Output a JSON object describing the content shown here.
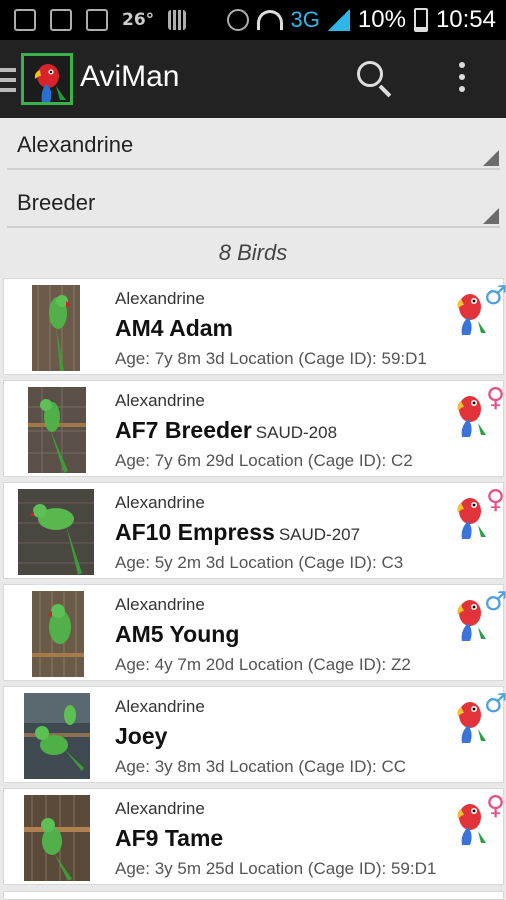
{
  "status_bar": {
    "temperature": "26°",
    "network": "3G",
    "battery": "10%",
    "time": "10:54"
  },
  "action_bar": {
    "app_title": "AviMan"
  },
  "filters": {
    "species": "Alexandrine",
    "category": "Breeder"
  },
  "count_label": "8 Birds",
  "birds": [
    {
      "species": "Alexandrine",
      "name": "AM4 Adam",
      "ring": "",
      "age": "Age: 7y 8m 3d",
      "location": "Location (Cage ID): 59:D1",
      "sex": "male",
      "sex_symbol": "♂"
    },
    {
      "species": "Alexandrine",
      "name": "AF7 Breeder",
      "ring": "SAUD-208",
      "age": "Age: 7y 6m 29d",
      "location": "Location (Cage ID): C2",
      "sex": "female",
      "sex_symbol": "♀"
    },
    {
      "species": "Alexandrine",
      "name": "AF10 Empress",
      "ring": "SAUD-207",
      "age": "Age: 5y 2m 3d",
      "location": "Location (Cage ID): C3",
      "sex": "female",
      "sex_symbol": "♀"
    },
    {
      "species": "Alexandrine",
      "name": "AM5 Young",
      "ring": "",
      "age": "Age: 4y 7m 20d",
      "location": "Location (Cage ID): Z2",
      "sex": "male",
      "sex_symbol": "♂"
    },
    {
      "species": "Alexandrine",
      "name": "Joey",
      "ring": "",
      "age": "Age: 3y 8m 3d",
      "location": "Location (Cage ID): CC",
      "sex": "male",
      "sex_symbol": "♂"
    },
    {
      "species": "Alexandrine",
      "name": "AF9 Tame",
      "ring": "",
      "age": "Age: 3y 5m 25d",
      "location": "Location (Cage ID): 59:D1",
      "sex": "female",
      "sex_symbol": "♀"
    }
  ],
  "colors": {
    "action_bar": "#222222",
    "accent_blue": "#2fb6e8",
    "male": "#4aa0e0",
    "female": "#e8508a"
  }
}
